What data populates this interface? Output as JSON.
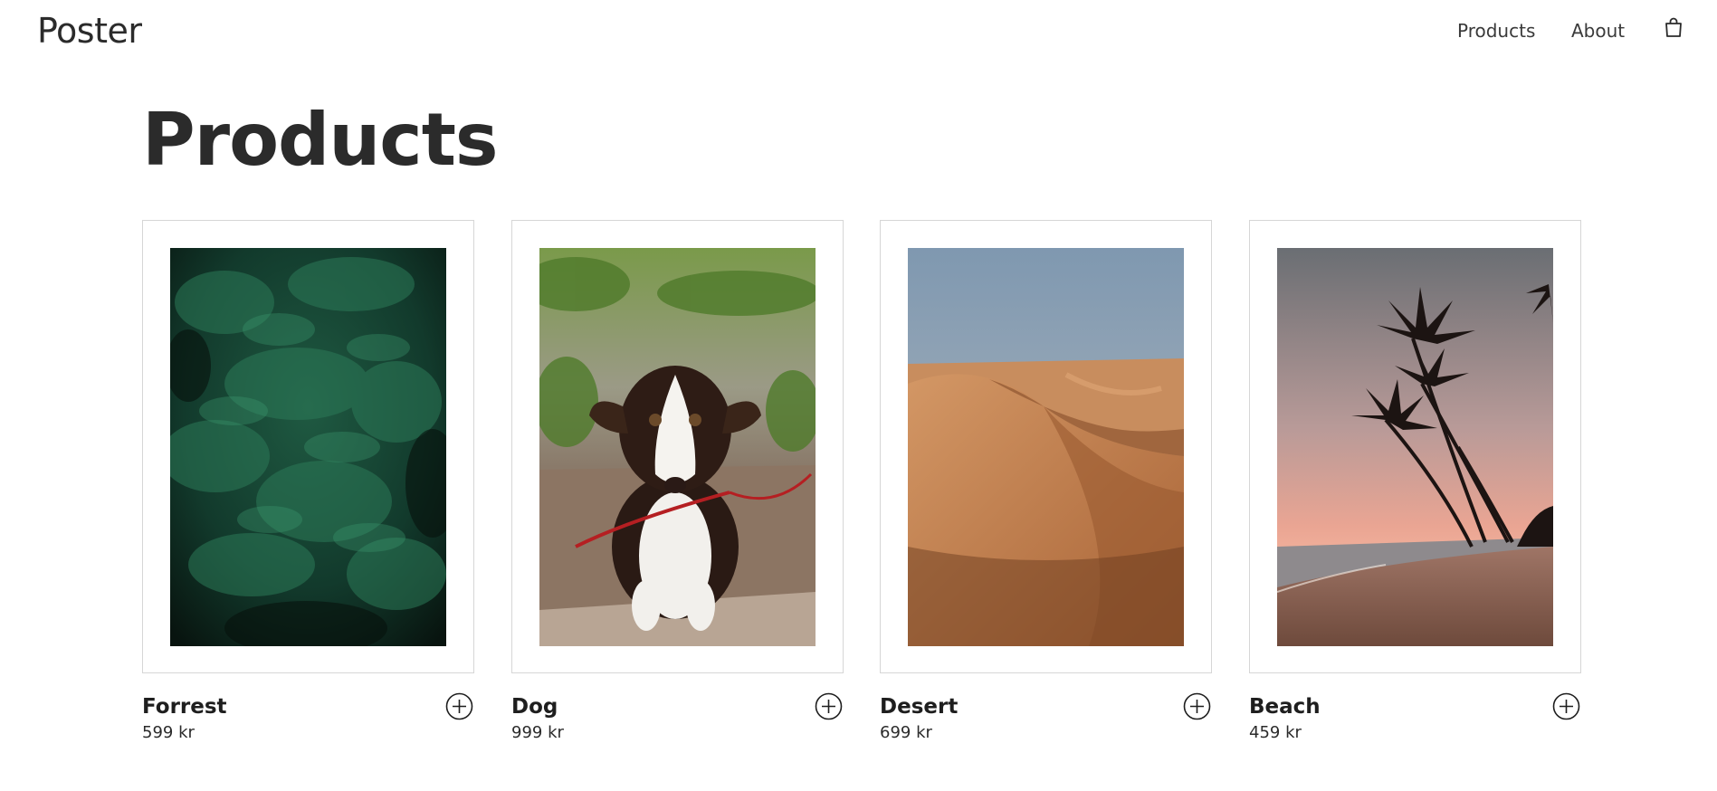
{
  "header": {
    "brand": "Poster",
    "nav": [
      {
        "label": "Products"
      },
      {
        "label": "About"
      }
    ],
    "cart_icon": "shopping-bag-icon"
  },
  "main": {
    "title": "Products",
    "products": [
      {
        "name": "Forrest",
        "price": "599 kr",
        "image": "forest-photo",
        "action_icon": "plus-circle-icon"
      },
      {
        "name": "Dog",
        "price": "999 kr",
        "image": "dog-photo",
        "action_icon": "plus-circle-icon"
      },
      {
        "name": "Desert",
        "price": "699 kr",
        "image": "desert-photo",
        "action_icon": "plus-circle-icon"
      },
      {
        "name": "Beach",
        "price": "459 kr",
        "image": "beach-photo",
        "action_icon": "plus-circle-icon"
      }
    ]
  },
  "colors": {
    "text": "#2b2b2b",
    "card_border": "#d6d6d6",
    "background": "#ffffff"
  }
}
